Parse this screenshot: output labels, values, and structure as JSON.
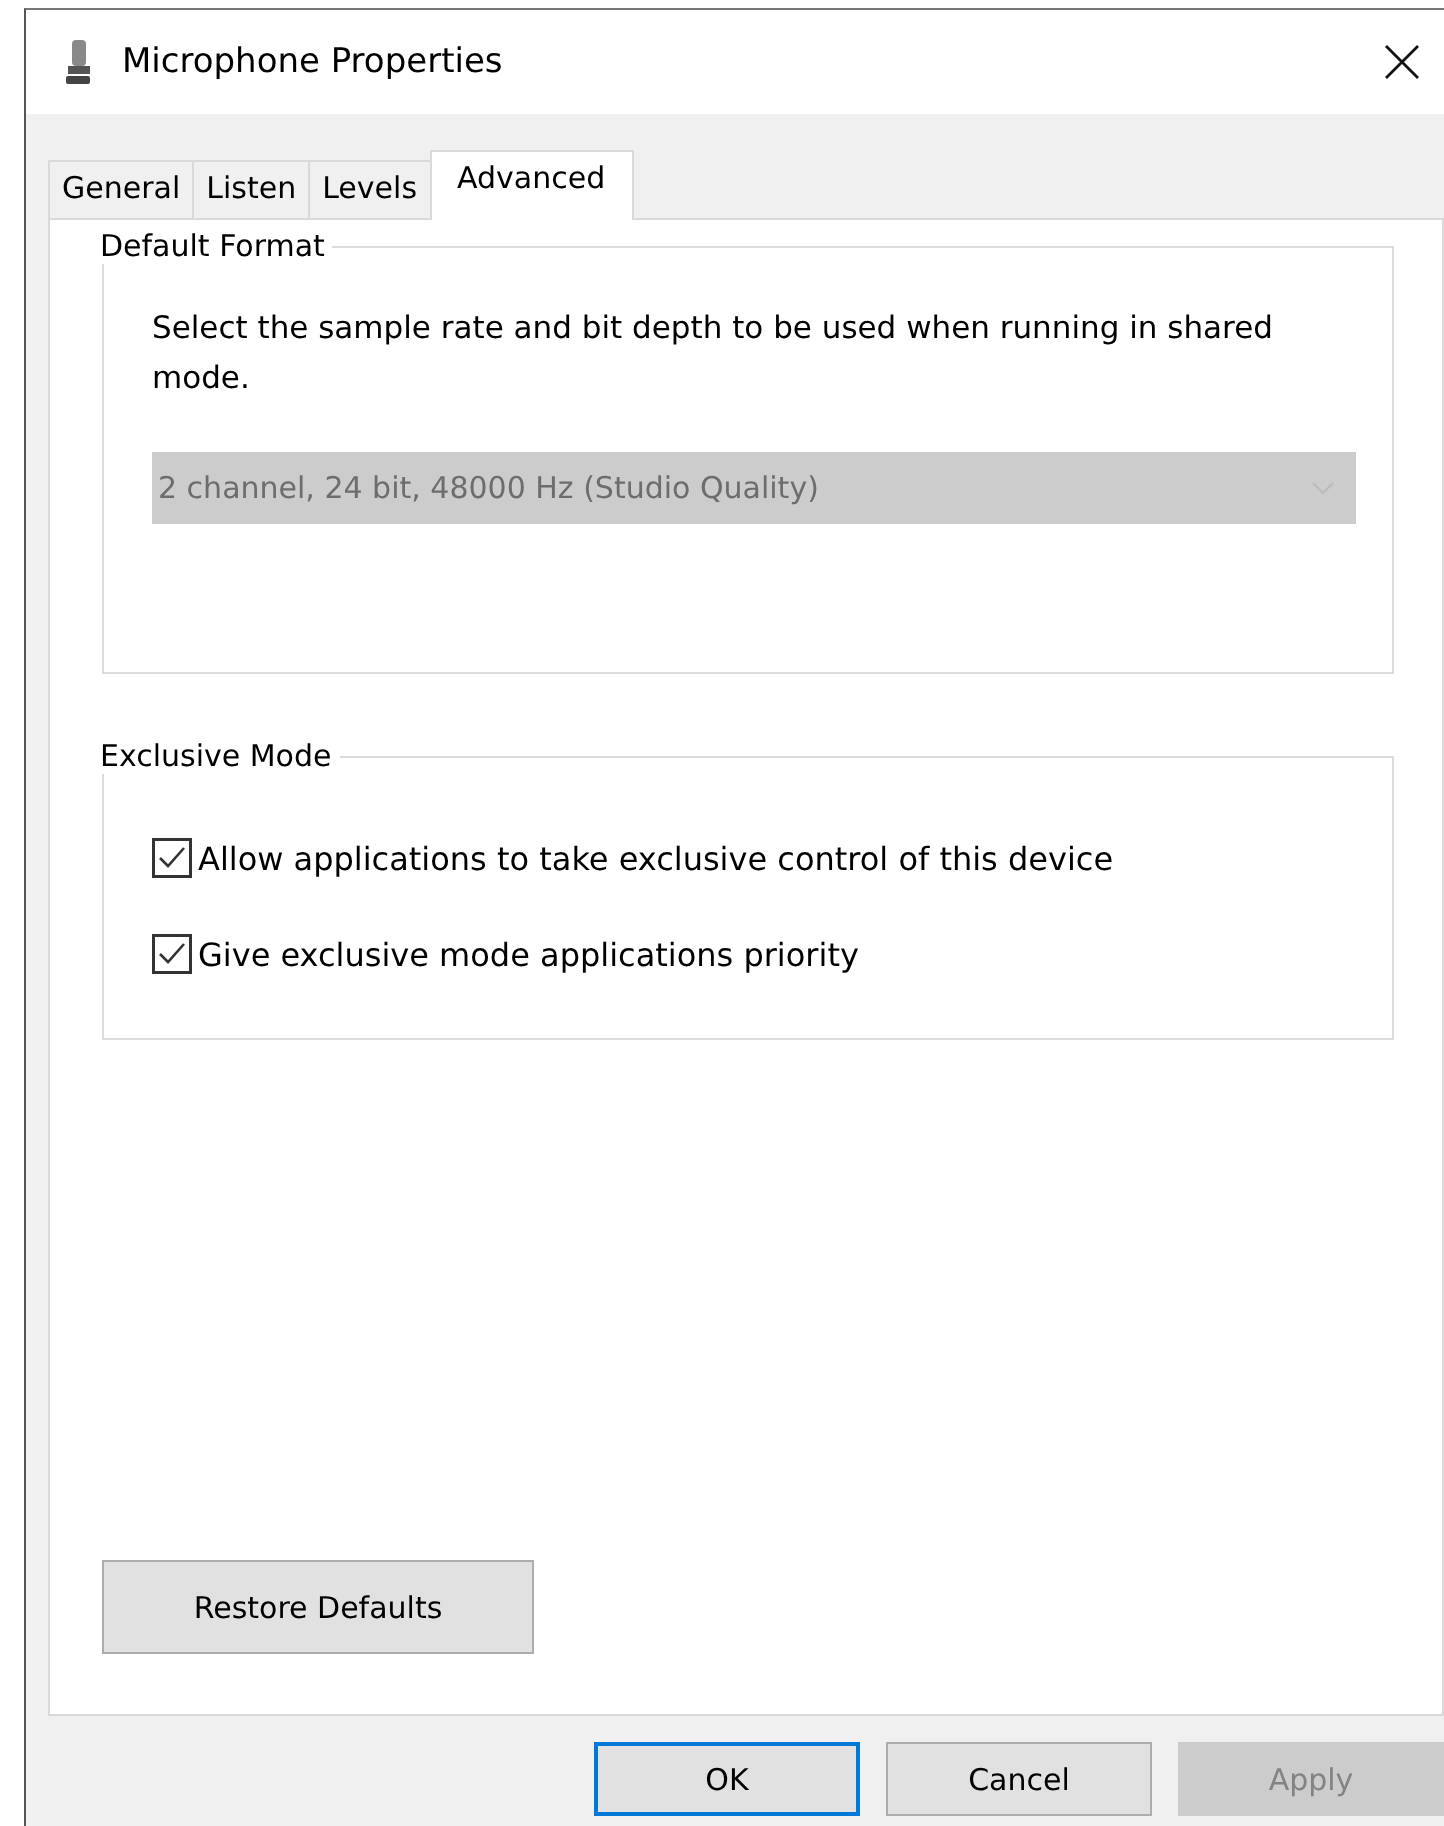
{
  "window": {
    "title": "Microphone Properties"
  },
  "tabs": [
    {
      "label": "General",
      "selected": false
    },
    {
      "label": "Listen",
      "selected": false
    },
    {
      "label": "Levels",
      "selected": false
    },
    {
      "label": "Advanced",
      "selected": true
    }
  ],
  "default_format": {
    "title": "Default Format",
    "description": "Select the sample rate and bit depth to be used when running in shared mode.",
    "dropdown": {
      "value": "2 channel, 24 bit, 48000 Hz (Studio Quality)",
      "disabled": true
    }
  },
  "exclusive_mode": {
    "title": "Exclusive Mode",
    "options": [
      {
        "label": "Allow applications to take exclusive control of this device",
        "checked": true
      },
      {
        "label": "Give exclusive mode applications priority",
        "checked": true
      }
    ]
  },
  "restore_button": "Restore Defaults",
  "buttons": [
    {
      "label": "OK",
      "default": true,
      "disabled": false
    },
    {
      "label": "Cancel",
      "default": false,
      "disabled": false
    },
    {
      "label": "Apply",
      "default": false,
      "disabled": true
    }
  ]
}
